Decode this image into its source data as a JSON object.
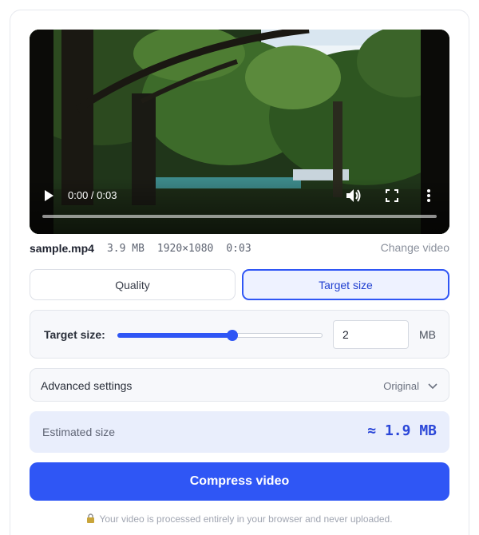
{
  "player": {
    "time": "0:00 / 0:03",
    "progress": 0.0,
    "icons": {
      "play": "play-icon",
      "volume": "volume-icon",
      "fullscreen": "fullscreen-icon",
      "more": "more-vertical-icon"
    }
  },
  "file": {
    "name": "sample.mp4",
    "size": "3.9 MB",
    "resolution": "1920×1080",
    "duration": "0:03",
    "change_label": "Change video"
  },
  "tabs": [
    {
      "label": "Quality",
      "active": false
    },
    {
      "label": "Target size",
      "active": true
    }
  ],
  "target": {
    "label": "Target size:",
    "slider_fraction": 0.56,
    "value": "2",
    "unit": "MB"
  },
  "advanced": {
    "label": "Advanced settings",
    "value": "Original"
  },
  "estimate": {
    "label": "Estimated size",
    "value": "≈ 1.9 MB"
  },
  "compress_label": "Compress video",
  "footer_note": "Your video is processed entirely in your browser and never uploaded.",
  "colors": {
    "accent": "#2f56f5",
    "accent_text": "#2b47d8",
    "estimate_bg": "#e9eefc"
  }
}
